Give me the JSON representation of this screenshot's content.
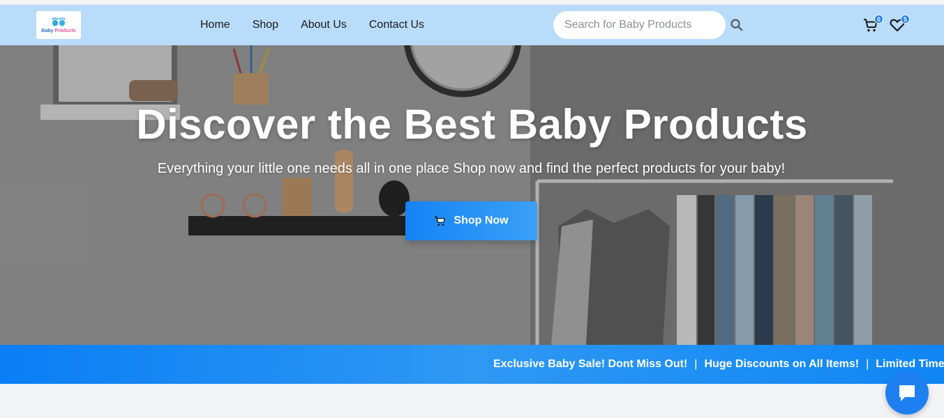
{
  "header": {
    "logo": {
      "text_a": "Baby ",
      "text_b": "Products",
      "icon": "baby-feet-icon"
    },
    "nav": [
      {
        "label": "Home"
      },
      {
        "label": "Shop"
      },
      {
        "label": "About Us"
      },
      {
        "label": "Contact Us"
      }
    ],
    "search": {
      "placeholder": "Search for Baby Products",
      "value": "",
      "icon": "search-icon"
    },
    "cart": {
      "count": "0",
      "icon": "cart-icon"
    },
    "wishlist": {
      "count": "5",
      "icon": "heart-icon"
    }
  },
  "hero": {
    "title": "Discover the Best Baby Products",
    "subtitle": "Everything your little one needs all in one place Shop now and find the perfect products for your baby!",
    "cta_label": "Shop Now",
    "cta_icon": "cart-icon"
  },
  "ticker": {
    "items": [
      "Exclusive Baby Sale! Dont Miss Out!",
      "Huge Discounts on All Items!",
      "Limited Time"
    ],
    "separator": "|"
  },
  "chat": {
    "icon": "chat-bubble-icon"
  },
  "colors": {
    "nav_bg": "#b9dcfb",
    "accent": "#1e7ff0",
    "ticker_bg": "#0a7ef5",
    "page_bg": "#f2f3f5"
  }
}
